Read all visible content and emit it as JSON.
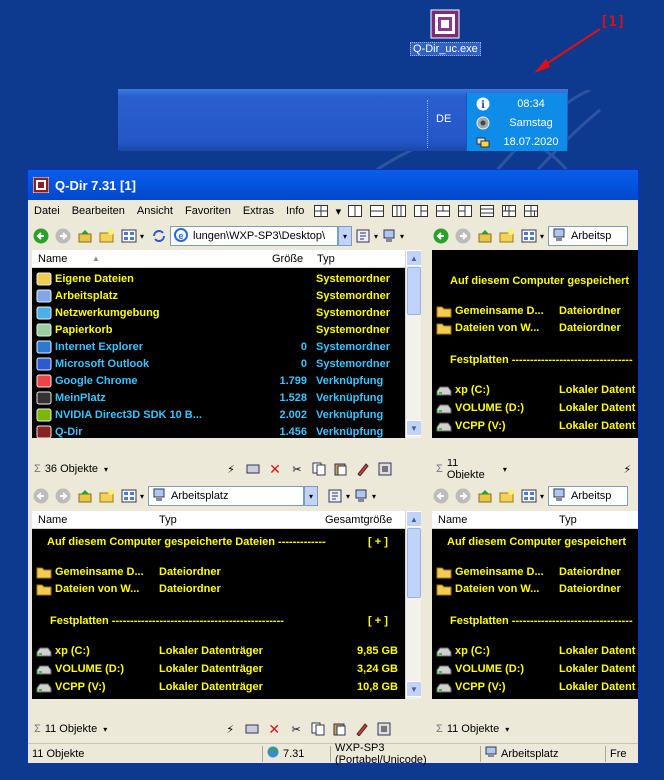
{
  "desktop": {
    "icon_label": "Q-Dir_uc.exe",
    "annotation": "[1]"
  },
  "tray": {
    "lang": "DE",
    "time": "08:34",
    "day": "Samstag",
    "date": "18.07.2020"
  },
  "window": {
    "title": "Q-Dir 7.31 [1]",
    "menu": [
      "Datei",
      "Bearbeiten",
      "Ansicht",
      "Favoriten",
      "Extras",
      "Info"
    ],
    "panes": {
      "tl": {
        "address": "lungen\\WXP-SP3\\Desktop\\",
        "cols": {
          "name": "Name",
          "size": "Größe",
          "type": "Typ"
        },
        "rows": [
          {
            "name": "Eigene Dateien",
            "size": "",
            "type": "Systemordner",
            "color": "yellow",
            "icon": "my-documents-icon"
          },
          {
            "name": "Arbeitsplatz",
            "size": "",
            "type": "Systemordner",
            "color": "yellow",
            "icon": "my-computer-icon"
          },
          {
            "name": "Netzwerkumgebung",
            "size": "",
            "type": "Systemordner",
            "color": "yellow",
            "icon": "network-icon"
          },
          {
            "name": "Papierkorb",
            "size": "",
            "type": "Systemordner",
            "color": "yellow",
            "icon": "recycle-bin-icon"
          },
          {
            "name": "Internet Explorer",
            "size": "0",
            "type": "Systemordner",
            "color": "cyan",
            "icon": "ie-icon"
          },
          {
            "name": "Microsoft Outlook",
            "size": "0",
            "type": "Systemordner",
            "color": "cyan",
            "icon": "outlook-icon"
          },
          {
            "name": "Google Chrome",
            "size": "1.799",
            "type": "Verknüpfung",
            "color": "cyan",
            "icon": "chrome-icon"
          },
          {
            "name": "MeinPlatz",
            "size": "1.528",
            "type": "Verknüpfung",
            "color": "cyan",
            "icon": "meinplatz-icon"
          },
          {
            "name": "NVIDIA Direct3D SDK 10 B...",
            "size": "2.002",
            "type": "Verknüpfung",
            "color": "cyan",
            "icon": "nvidia-icon"
          },
          {
            "name": "Q-Dir",
            "size": "1.456",
            "type": "Verknüpfung",
            "color": "cyan",
            "icon": "qdir-icon"
          }
        ],
        "status": "36 Objekte"
      },
      "tr": {
        "address": "Arbeitsp",
        "group_header": "Auf diesem Computer gespeichert",
        "folders": [
          {
            "name": "Gemeinsame D...",
            "type": "Dateiordner"
          },
          {
            "name": "Dateien von W...",
            "type": "Dateiordner"
          }
        ],
        "drives_header": "Festplatten ---------------------------------",
        "drives": [
          {
            "name": "xp (C:)",
            "type": "Lokaler Datent"
          },
          {
            "name": "VOLUME (D:)",
            "type": "Lokaler Datent"
          },
          {
            "name": "VCPP (V:)",
            "type": "Lokaler Datent"
          }
        ],
        "status": "11 Objekte"
      },
      "bl": {
        "address": "Arbeitsplatz",
        "cols": {
          "name": "Name",
          "type": "Typ",
          "size": "Gesamtgröße"
        },
        "group_header": "Auf diesem Computer gespeicherte Dateien -------------",
        "group_toggle": "[ + ]",
        "folders": [
          {
            "name": "Gemeinsame D...",
            "type": "Dateiordner"
          },
          {
            "name": "Dateien von W...",
            "type": "Dateiordner"
          }
        ],
        "drives_header": "Festplatten -----------------------------------------------",
        "drives_toggle": "[ + ]",
        "drives": [
          {
            "name": "xp (C:)",
            "type": "Lokaler Datenträger",
            "size": "9,85 GB"
          },
          {
            "name": "VOLUME (D:)",
            "type": "Lokaler Datenträger",
            "size": "3,24 GB"
          },
          {
            "name": "VCPP (V:)",
            "type": "Lokaler Datenträger",
            "size": "10,8 GB"
          }
        ],
        "status": "11 Objekte"
      },
      "br": {
        "address": "Arbeitsp",
        "cols": {
          "name": "Name",
          "type": "Typ"
        },
        "group_header": "Auf diesem Computer gespeichert",
        "folders": [
          {
            "name": "Gemeinsame D...",
            "type": "Dateiordner"
          },
          {
            "name": "Dateien von W...",
            "type": "Dateiordner"
          }
        ],
        "drives_header": "Festplatten ---------------------------------",
        "drives": [
          {
            "name": "xp (C:)",
            "type": "Lokaler Datent"
          },
          {
            "name": "VOLUME (D:)",
            "type": "Lokaler Datent"
          },
          {
            "name": "VCPP (V:)",
            "type": "Lokaler Datent"
          }
        ],
        "status": "11 Objekte"
      }
    },
    "statusbar": {
      "objects": "11 Objekte",
      "version": "7.31",
      "build": "WXP-SP3 (Portabel/Unicode)",
      "location": "Arbeitsplatz",
      "extra": "Fre"
    }
  }
}
